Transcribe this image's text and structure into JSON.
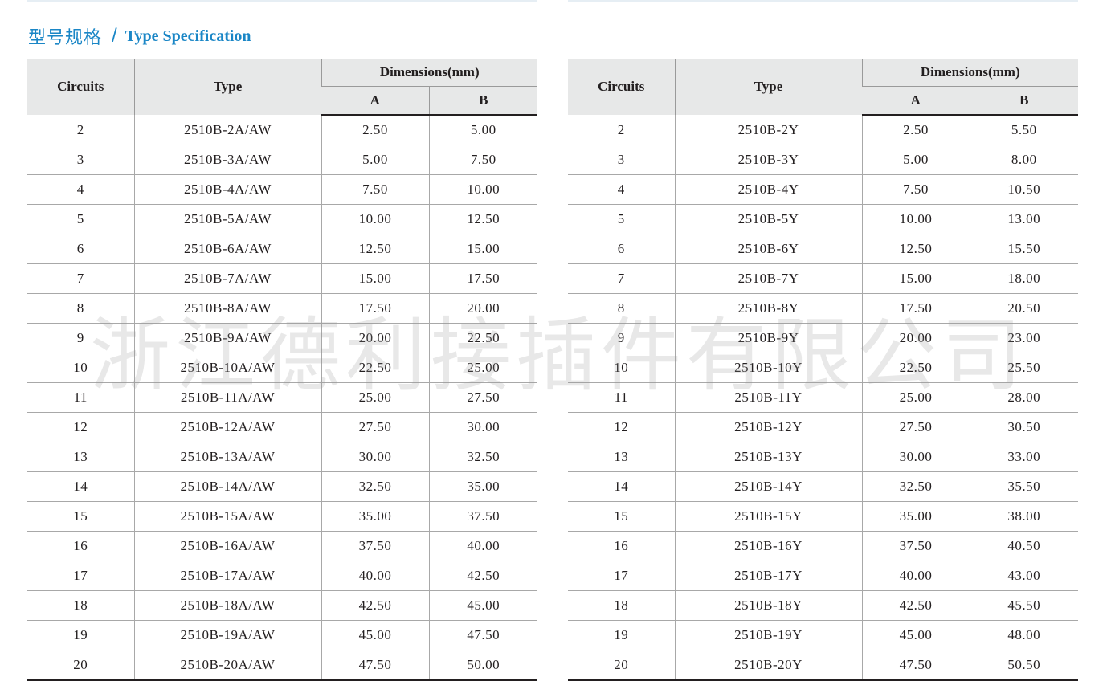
{
  "title": {
    "cn": "型号规格",
    "separator": "/",
    "en": "Type Specification"
  },
  "colors": {
    "accent": "#1a86c6",
    "header_bg": "#e7e8e8",
    "text": "#231f20"
  },
  "tables": [
    {
      "headers": {
        "circuits": "Circuits",
        "type": "Type",
        "dimensions": "Dimensions(mm)",
        "a": "A",
        "b": "B"
      },
      "rows": [
        [
          "2",
          "2510B-2A/AW",
          "2.50",
          "5.00"
        ],
        [
          "3",
          "2510B-3A/AW",
          "5.00",
          "7.50"
        ],
        [
          "4",
          "2510B-4A/AW",
          "7.50",
          "10.00"
        ],
        [
          "5",
          "2510B-5A/AW",
          "10.00",
          "12.50"
        ],
        [
          "6",
          "2510B-6A/AW",
          "12.50",
          "15.00"
        ],
        [
          "7",
          "2510B-7A/AW",
          "15.00",
          "17.50"
        ],
        [
          "8",
          "2510B-8A/AW",
          "17.50",
          "20.00"
        ],
        [
          "9",
          "2510B-9A/AW",
          "20.00",
          "22.50"
        ],
        [
          "10",
          "2510B-10A/AW",
          "22.50",
          "25.00"
        ],
        [
          "11",
          "2510B-11A/AW",
          "25.00",
          "27.50"
        ],
        [
          "12",
          "2510B-12A/AW",
          "27.50",
          "30.00"
        ],
        [
          "13",
          "2510B-13A/AW",
          "30.00",
          "32.50"
        ],
        [
          "14",
          "2510B-14A/AW",
          "32.50",
          "35.00"
        ],
        [
          "15",
          "2510B-15A/AW",
          "35.00",
          "37.50"
        ],
        [
          "16",
          "2510B-16A/AW",
          "37.50",
          "40.00"
        ],
        [
          "17",
          "2510B-17A/AW",
          "40.00",
          "42.50"
        ],
        [
          "18",
          "2510B-18A/AW",
          "42.50",
          "45.00"
        ],
        [
          "19",
          "2510B-19A/AW",
          "45.00",
          "47.50"
        ],
        [
          "20",
          "2510B-20A/AW",
          "47.50",
          "50.00"
        ]
      ]
    },
    {
      "headers": {
        "circuits": "Circuits",
        "type": "Type",
        "dimensions": "Dimensions(mm)",
        "a": "A",
        "b": "B"
      },
      "rows": [
        [
          "2",
          "2510B-2Y",
          "2.50",
          "5.50"
        ],
        [
          "3",
          "2510B-3Y",
          "5.00",
          "8.00"
        ],
        [
          "4",
          "2510B-4Y",
          "7.50",
          "10.50"
        ],
        [
          "5",
          "2510B-5Y",
          "10.00",
          "13.00"
        ],
        [
          "6",
          "2510B-6Y",
          "12.50",
          "15.50"
        ],
        [
          "7",
          "2510B-7Y",
          "15.00",
          "18.00"
        ],
        [
          "8",
          "2510B-8Y",
          "17.50",
          "20.50"
        ],
        [
          "9",
          "2510B-9Y",
          "20.00",
          "23.00"
        ],
        [
          "10",
          "2510B-10Y",
          "22.50",
          "25.50"
        ],
        [
          "11",
          "2510B-11Y",
          "25.00",
          "28.00"
        ],
        [
          "12",
          "2510B-12Y",
          "27.50",
          "30.50"
        ],
        [
          "13",
          "2510B-13Y",
          "30.00",
          "33.00"
        ],
        [
          "14",
          "2510B-14Y",
          "32.50",
          "35.50"
        ],
        [
          "15",
          "2510B-15Y",
          "35.00",
          "38.00"
        ],
        [
          "16",
          "2510B-16Y",
          "37.50",
          "40.50"
        ],
        [
          "17",
          "2510B-17Y",
          "40.00",
          "43.00"
        ],
        [
          "18",
          "2510B-18Y",
          "42.50",
          "45.50"
        ],
        [
          "19",
          "2510B-19Y",
          "45.00",
          "48.00"
        ],
        [
          "20",
          "2510B-20Y",
          "47.50",
          "50.50"
        ]
      ]
    }
  ],
  "watermark": "浙江德利接插件有限公司"
}
